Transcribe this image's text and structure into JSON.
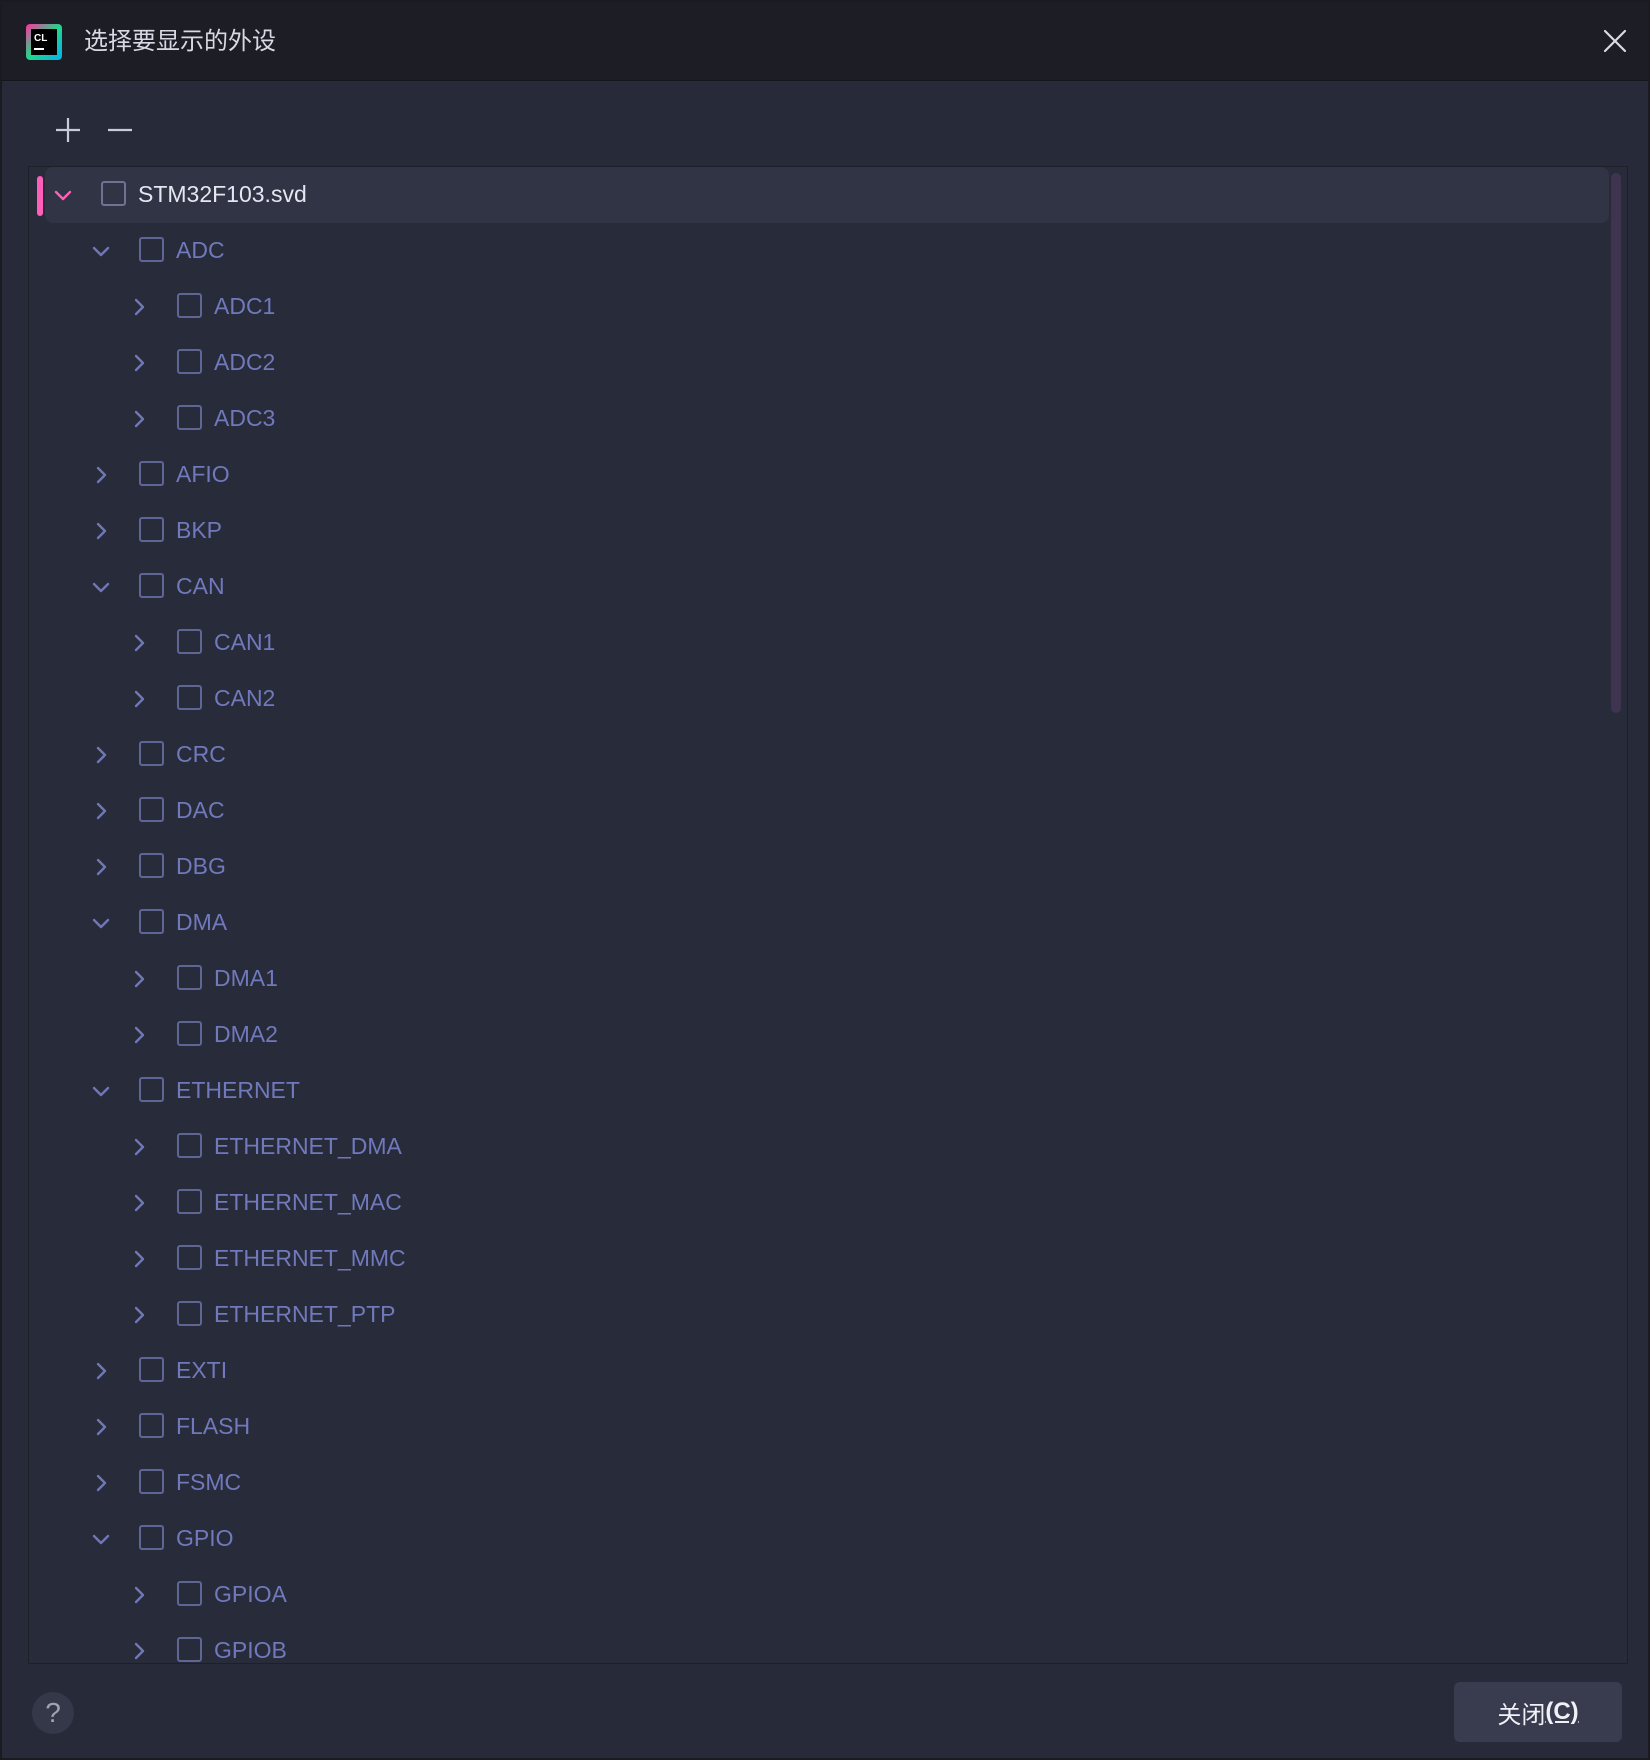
{
  "dialog": {
    "title": "选择要显示的外设",
    "app_icon": "clion-logo-icon",
    "close_icon": "close-icon"
  },
  "toolbar": {
    "add_icon": "plus-icon",
    "remove_icon": "minus-icon"
  },
  "tree": {
    "rows": [
      {
        "label": "STM32F103.svd",
        "depth": 0,
        "expanded": true,
        "checked": false,
        "selected": true
      },
      {
        "label": "ADC",
        "depth": 1,
        "expanded": true,
        "checked": false
      },
      {
        "label": "ADC1",
        "depth": 2,
        "expanded": false,
        "checked": false
      },
      {
        "label": "ADC2",
        "depth": 2,
        "expanded": false,
        "checked": false
      },
      {
        "label": "ADC3",
        "depth": 2,
        "expanded": false,
        "checked": false
      },
      {
        "label": "AFIO",
        "depth": 1,
        "expanded": false,
        "checked": false
      },
      {
        "label": "BKP",
        "depth": 1,
        "expanded": false,
        "checked": false
      },
      {
        "label": "CAN",
        "depth": 1,
        "expanded": true,
        "checked": false
      },
      {
        "label": "CAN1",
        "depth": 2,
        "expanded": false,
        "checked": false
      },
      {
        "label": "CAN2",
        "depth": 2,
        "expanded": false,
        "checked": false
      },
      {
        "label": "CRC",
        "depth": 1,
        "expanded": false,
        "checked": false
      },
      {
        "label": "DAC",
        "depth": 1,
        "expanded": false,
        "checked": false
      },
      {
        "label": "DBG",
        "depth": 1,
        "expanded": false,
        "checked": false
      },
      {
        "label": "DMA",
        "depth": 1,
        "expanded": true,
        "checked": false
      },
      {
        "label": "DMA1",
        "depth": 2,
        "expanded": false,
        "checked": false
      },
      {
        "label": "DMA2",
        "depth": 2,
        "expanded": false,
        "checked": false
      },
      {
        "label": "ETHERNET",
        "depth": 1,
        "expanded": true,
        "checked": false
      },
      {
        "label": "ETHERNET_DMA",
        "depth": 2,
        "expanded": false,
        "checked": false
      },
      {
        "label": "ETHERNET_MAC",
        "depth": 2,
        "expanded": false,
        "checked": false
      },
      {
        "label": "ETHERNET_MMC",
        "depth": 2,
        "expanded": false,
        "checked": false
      },
      {
        "label": "ETHERNET_PTP",
        "depth": 2,
        "expanded": false,
        "checked": false
      },
      {
        "label": "EXTI",
        "depth": 1,
        "expanded": false,
        "checked": false
      },
      {
        "label": "FLASH",
        "depth": 1,
        "expanded": false,
        "checked": false
      },
      {
        "label": "FSMC",
        "depth": 1,
        "expanded": false,
        "checked": false
      },
      {
        "label": "GPIO",
        "depth": 1,
        "expanded": true,
        "checked": false
      },
      {
        "label": "GPIOA",
        "depth": 2,
        "expanded": false,
        "checked": false
      },
      {
        "label": "GPIOB",
        "depth": 2,
        "expanded": false,
        "checked": false
      }
    ]
  },
  "footer": {
    "help_label": "?",
    "close_label": "关闭",
    "close_mnemonic": "(C)"
  },
  "colors": {
    "selection_marker": "#ff5fb8",
    "item_text": "#7079bb",
    "root_text": "#e4e6f0"
  }
}
